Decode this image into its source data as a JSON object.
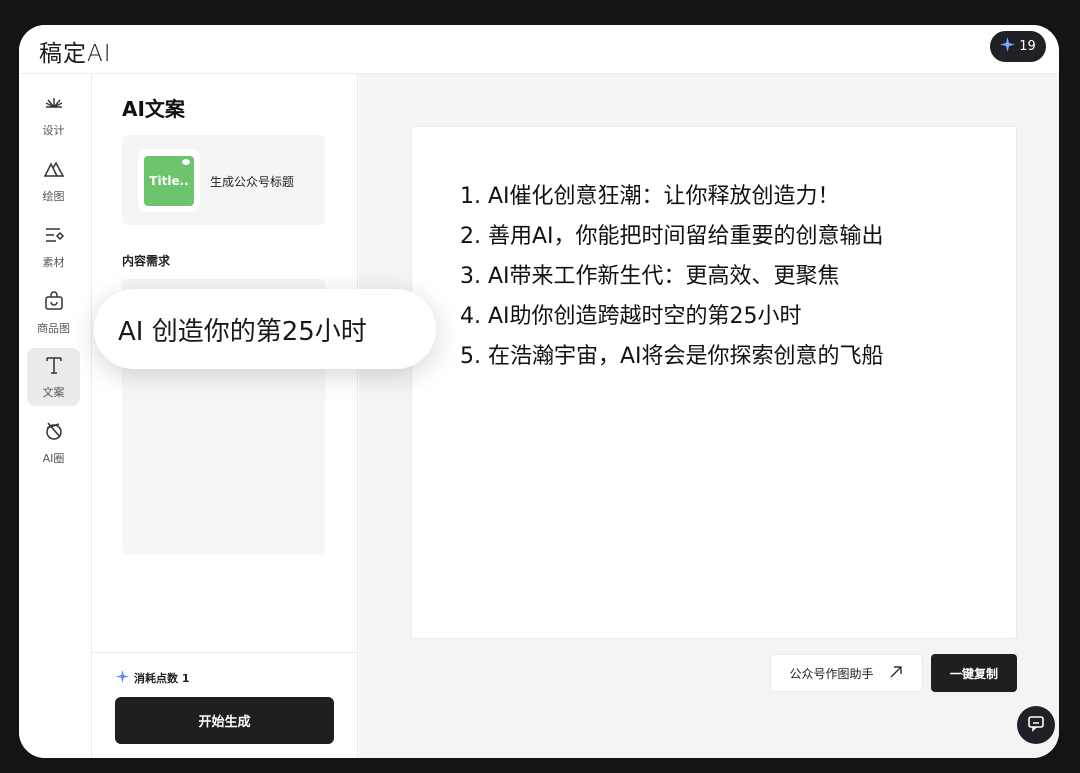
{
  "app": {
    "logo": "稿定AI"
  },
  "topbar": {
    "credits": "19"
  },
  "nav": {
    "items": [
      {
        "label": "设计",
        "icon": "design-icon"
      },
      {
        "label": "绘图",
        "icon": "drawing-icon"
      },
      {
        "label": "素材",
        "icon": "assets-icon"
      },
      {
        "label": "商品图",
        "icon": "product-image-icon"
      },
      {
        "label": "文案",
        "icon": "text-icon",
        "active": true
      },
      {
        "label": "AI圈",
        "icon": "ai-circle-icon"
      }
    ]
  },
  "panel": {
    "title": "AI文案",
    "template": {
      "thumb_text": "Title..",
      "label": "生成公众号标题"
    },
    "content_label": "内容需求",
    "cost_label": "消耗点数 1",
    "start_label": "开始生成"
  },
  "floating_pill": {
    "text": "AI  创造你的第25小时"
  },
  "results": {
    "items": [
      "1.  AI催化创意狂潮：让你释放创造力！",
      "2. 善用AI，你能把时间留给重要的创意输出",
      "3. AI带来工作新生代：更高效、更聚焦",
      "4. AI助你创造跨越时空的第25小时",
      "5. 在浩瀚宇宙，AI将会是你探索创意的飞船"
    ]
  },
  "actions": {
    "helper_label": "公众号作图助手",
    "copy_label": "一键复制"
  },
  "colors": {
    "dark": "#1f1f1f",
    "accent_green": "#6cc56c",
    "sparkle_blue": "#5b8def"
  }
}
